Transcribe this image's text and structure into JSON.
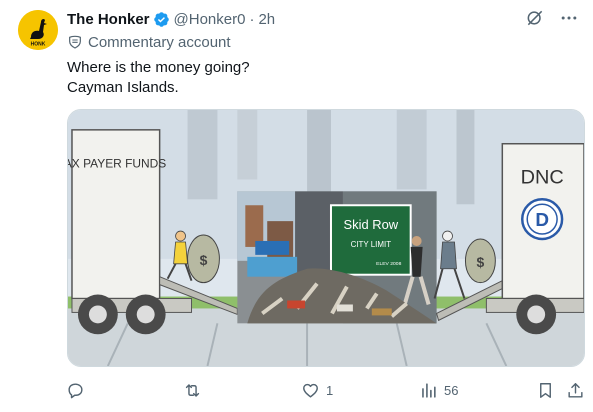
{
  "author": {
    "display_name": "The Honker",
    "handle": "@Honker0",
    "separator": "·",
    "timestamp": "2h",
    "avatar_text": "HONK"
  },
  "account_label": "Commentary account",
  "body": {
    "line1": "Where is the money going?",
    "line2": "Cayman Islands."
  },
  "media": {
    "truck_left_text": "TAX PAYER FUNDS",
    "truck_right_text": "DNC",
    "party_letter": "D",
    "sign_title": "Skid Row",
    "sign_subtitle": "CITY LIMIT",
    "sign_elev": "ELEV 2008"
  },
  "actions": {
    "reply_count": "",
    "retweet_count": "",
    "like_count": "1",
    "view_count": "56"
  },
  "colors": {
    "verified_blue": "#1d9bf0",
    "secondary_text": "#536471",
    "avatar_yellow": "#f6c400"
  },
  "icons": {
    "verified": "verified-badge-icon",
    "grok": "grok-icon",
    "more": "more-icon",
    "label": "commentary-label-icon",
    "reply": "reply-icon",
    "retweet": "retweet-icon",
    "like": "like-icon",
    "views": "views-icon",
    "bookmark": "bookmark-icon",
    "share": "share-icon"
  }
}
